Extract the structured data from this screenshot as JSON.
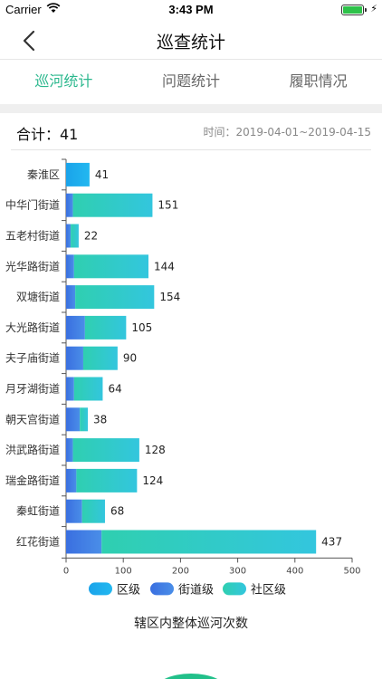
{
  "status_bar": {
    "carrier": "Carrier",
    "time": "3:43 PM"
  },
  "nav": {
    "title": "巡查统计",
    "back_icon": "chevron-left-icon"
  },
  "tabs": [
    {
      "label": "巡河统计",
      "active": true
    },
    {
      "label": "问题统计",
      "active": false
    },
    {
      "label": "履职情况",
      "active": false
    }
  ],
  "summary": {
    "total_label": "合计：41",
    "date_range": "时间：2019-04-01~2019-04-15"
  },
  "colors": {
    "accent": "#2cb88e",
    "district": "#1aa3ea",
    "street_start": "#3a6fe0",
    "street_end": "#4a8ee8",
    "community_start": "#2fcfb0",
    "community_end": "#33c6de"
  },
  "chart_data": {
    "type": "bar",
    "orientation": "horizontal",
    "stacked": true,
    "categories": [
      "秦淮区",
      "中华门街道",
      "五老村街道",
      "光华路街道",
      "双塘街道",
      "大光路街道",
      "夫子庙街道",
      "月牙湖街道",
      "朝天宫街道",
      "洪武路街道",
      "瑞金路街道",
      "秦虹街道",
      "红花街道"
    ],
    "series": [
      {
        "name": "区级",
        "values": [
          41,
          0,
          0,
          0,
          0,
          0,
          0,
          0,
          0,
          0,
          0,
          0,
          0
        ]
      },
      {
        "name": "街道级",
        "values": [
          0,
          12,
          8,
          14,
          16,
          33,
          30,
          14,
          24,
          12,
          18,
          28,
          62
        ]
      },
      {
        "name": "社区级",
        "values": [
          0,
          139,
          14,
          130,
          138,
          72,
          60,
          50,
          14,
          116,
          106,
          40,
          375
        ]
      }
    ],
    "totals": [
      41,
      151,
      22,
      144,
      154,
      105,
      90,
      64,
      38,
      128,
      124,
      68,
      437
    ],
    "xlim": [
      0,
      500
    ],
    "xticks": [
      0,
      100,
      200,
      300,
      400,
      500
    ],
    "legend_position": "bottom",
    "title": "辖区内整体巡河次数"
  }
}
